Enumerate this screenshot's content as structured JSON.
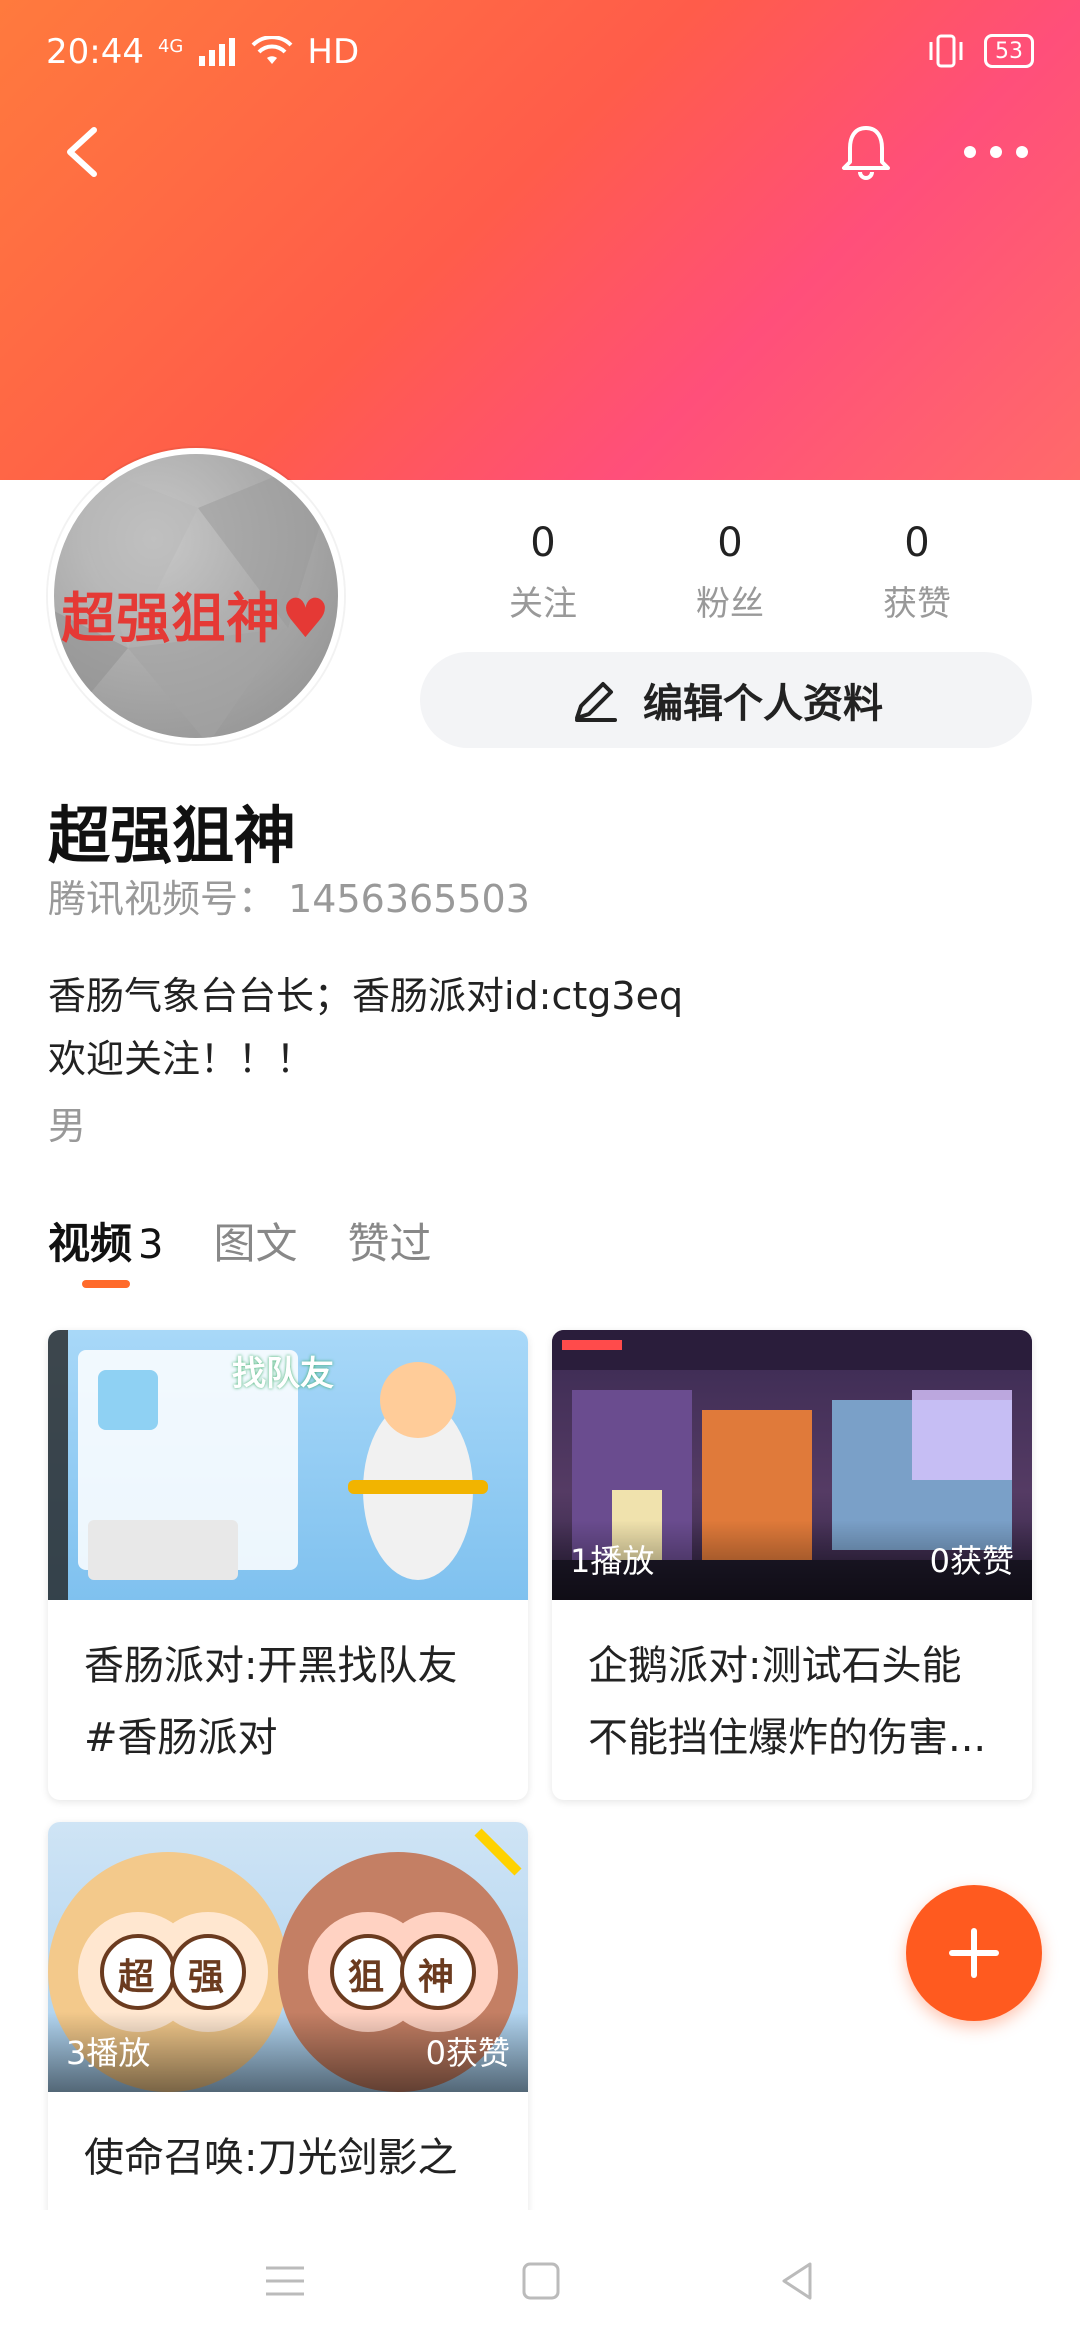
{
  "status_bar": {
    "time": "20:44",
    "network": "4G",
    "hd": "HD",
    "battery": "53"
  },
  "header": {
    "back_icon": "chevron-left-icon",
    "bell_icon": "bell-icon",
    "more_icon": "more-dots-icon"
  },
  "profile": {
    "avatar_text": "超强狙神♥",
    "name": "超强狙神",
    "id_label": "腾讯视频号：",
    "id_value": "1456365503",
    "bio_line1": "香肠气象台台长；香肠派对id:ctg3eq",
    "bio_line2": "欢迎关注！！！",
    "gender": "男"
  },
  "stats": [
    {
      "value": "0",
      "label": "关注"
    },
    {
      "value": "0",
      "label": "粉丝"
    },
    {
      "value": "0",
      "label": "获赞"
    }
  ],
  "edit_button": {
    "label": "编辑个人资料",
    "icon": "edit-pencil-icon"
  },
  "tabs": [
    {
      "label": "视频",
      "count": "3",
      "active": true
    },
    {
      "label": "图文",
      "count": ""
    },
    {
      "label": "赞过",
      "count": ""
    }
  ],
  "videos": [
    {
      "title": "香肠派对:开黑找队友 #香肠派对",
      "plays": "",
      "likes": "",
      "thumb_text": "找队友"
    },
    {
      "title": "企鹅派对:测试石头能不能挡住爆炸的伤害...",
      "plays": "1播放",
      "likes": "0获赞"
    },
    {
      "title": "使命召唤:刀光剑影之",
      "plays": "3播放",
      "likes": "0获赞",
      "thumb_text": [
        "超",
        "强",
        "狙",
        "神"
      ]
    }
  ],
  "fab": {
    "icon": "plus-icon"
  },
  "colors": {
    "accent": "#ff5a1f",
    "tab_indicator": "#ff6a2a"
  }
}
